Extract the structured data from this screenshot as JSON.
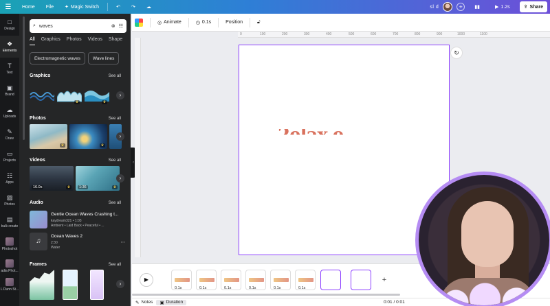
{
  "topbar": {
    "home": "Home",
    "file": "File",
    "magic_switch": "Magic Switch",
    "title": "sl d",
    "duration": "1.2s",
    "share": "Share"
  },
  "rail": {
    "items": [
      {
        "label": "Design",
        "icon": "□"
      },
      {
        "label": "Elements",
        "icon": "❖"
      },
      {
        "label": "Text",
        "icon": "T"
      },
      {
        "label": "Brand",
        "icon": "▣"
      },
      {
        "label": "Uploads",
        "icon": "☁"
      },
      {
        "label": "Draw",
        "icon": "✎"
      },
      {
        "label": "Projects",
        "icon": "▭"
      },
      {
        "label": "Apps",
        "icon": "☷"
      },
      {
        "label": "Photos",
        "icon": "▨"
      },
      {
        "label": "bulk create",
        "icon": "▤"
      },
      {
        "label": "Photoshot",
        "icon": ""
      },
      {
        "label": "adia Phot...",
        "icon": ""
      },
      {
        "label": "L Dunn St...",
        "icon": ""
      }
    ]
  },
  "panel": {
    "search_value": "waves",
    "tabs": [
      "All",
      "Graphics",
      "Photos",
      "Videos",
      "Shape"
    ],
    "chips": [
      "Electromagnetic waves",
      "Wave lines"
    ],
    "see_all": "See all",
    "sections": {
      "graphics": "Graphics",
      "photos": "Photos",
      "videos": "Videos",
      "audio": "Audio",
      "frames": "Frames"
    },
    "videos": [
      "16.0s",
      "1:36"
    ],
    "audio": [
      {
        "title": "Gentle Ocean Waves Crashing t...",
        "sub1": "kaydream321 • 1:03",
        "sub2": "Ambient • Laid Back • Peaceful • ..."
      },
      {
        "title": "Ocean Waves 2",
        "sub1": "2:30",
        "sub2": "Water"
      }
    ]
  },
  "toolbar": {
    "animate": "Animate",
    "time": "0.1s",
    "position": "Position"
  },
  "ruler": [
    "0",
    "100",
    "200",
    "300",
    "400",
    "500",
    "600",
    "700",
    "800",
    "900",
    "1000",
    "1100"
  ],
  "canvas": {
    "text": "2elax e"
  },
  "timeline": {
    "frame_durations": [
      "0.1s",
      "0.1s",
      "0.1s",
      "0.1s",
      "0.1s",
      "0.1s"
    ]
  },
  "statusbar": {
    "notes": "Notes",
    "duration": "Duration",
    "time": "0:01 / 0:01"
  },
  "colors": {
    "accent": "#8b3dff",
    "canvas_text": "#d9725e"
  }
}
